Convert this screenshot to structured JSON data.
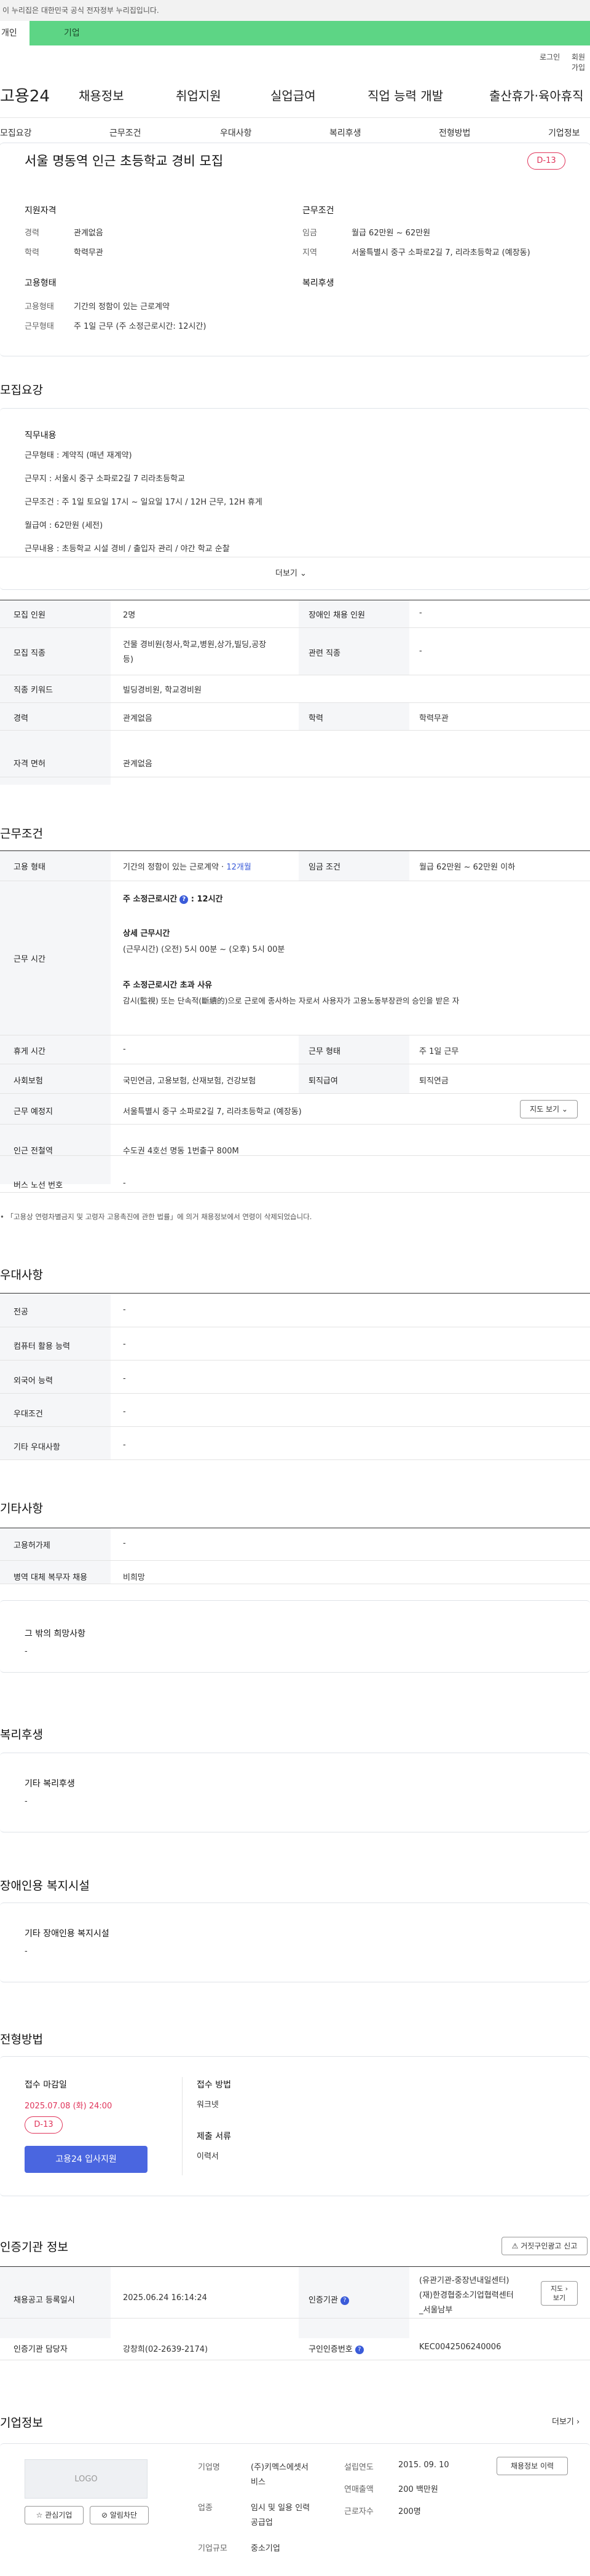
{
  "gov_bar": {
    "text": "이 누리집은 대한민국 공식 전자정부 누리집입니다."
  },
  "top_tabs": {
    "person": "개인",
    "company": "기업"
  },
  "util": {
    "login": "로그인",
    "signup": "회원가입"
  },
  "logo": "고용24",
  "gnb": [
    "채용정보",
    "취업지원",
    "실업급여",
    "직업 능력 개발",
    "출산휴가·육아휴직"
  ],
  "subnav": [
    "모집요강",
    "근무조건",
    "우대사항",
    "복리후생",
    "전형방법",
    "기업정보"
  ],
  "job": {
    "title": "서울 명동역 인근 초등학교 경비 모집",
    "dday": "D-13",
    "qual_heading": "지원자격",
    "career_label": "경력",
    "career_value": "관계없음",
    "edu_label": "학력",
    "edu_value": "학력무관",
    "cond_heading": "근무조건",
    "wage_label": "임금",
    "wage_value": "월급 62만원 ~ 62만원",
    "area_label": "지역",
    "area_value": "서울특별시 중구 소파로2길 7, 리라초등학교 (예장동)",
    "emp_heading": "고용형태",
    "emp_label": "고용형태",
    "emp_value": "기간의 정함이 있는 근로계약",
    "hours_label": "근무형태",
    "hours_value": "주 1일 근무 (주 소정근로시간: 12시간)",
    "welfare_heading": "복리후생"
  },
  "recruit": {
    "section_title": "모집요강",
    "detail_title": "직무내용",
    "lines": [
      "근무형태 : 계약직 (매년 재계약)",
      "근무지 : 서울시 중구 소파로2길 7 리라초등학교",
      "근무조건 : 주 1일 토요일  17시 ~ 일요일 17시 / 12H 근무, 12H 휴게",
      "월급여 : 62만원 (세전)",
      "근무내용 : 초등학교 시설 경비 / 출입자 관리 / 야간 학교 순찰"
    ],
    "more": "더보기",
    "table": [
      {
        "l1": "모집 인원",
        "v1": "2명",
        "l2": "장애인 채용 인원",
        "v2": "-"
      },
      {
        "l1": "모집 직종",
        "v1a": "건물 경비원(청사,학교,병원,상가,빌딩,공장",
        "v1b": "등)",
        "l2": "관련 직종",
        "v2": "-"
      },
      {
        "l1": "직종 키워드",
        "v1": "빌딩경비원, 학교경비원"
      },
      {
        "l1": "경력",
        "v1": "관계없음",
        "l2": "학력",
        "v2": "학력무관"
      },
      {
        "l1": "자격 면허",
        "v1": "관계없음"
      }
    ]
  },
  "work": {
    "section_title": "근무조건",
    "emp_label": "고용 형태",
    "emp_value": "기간의 정함이 있는 근로계약 · ",
    "emp_link": "12개월",
    "wage_label": "임금 조건",
    "wage_value": "월급 62만원 ~ 62만원 이하",
    "time_label": "근무 시간",
    "time_main": "주 소정근로시간",
    "time_main_value": ": 12시간",
    "time_detail_title": "상세 근무시간",
    "time_detail_value": "(근무시간) (오전) 5시 00분 ~ (오후) 5시 00분",
    "time_over_title": "주 소정근로시간 초과 사유",
    "time_over_value": "감시(監視) 또는 단속적(斷續的)으로 근로에 종사하는 자로서 사용자가 고용노동부장관의 승인을 받은 자",
    "rest_label": "휴게 시간",
    "rest_value": "-",
    "form_label": "근무 형태",
    "form_value": "주 1일 근무",
    "ins_label": "사회보험",
    "ins_value": "국민연금, 고용보험, 산재보험, 건강보험",
    "retire_label": "퇴직급여",
    "retire_value": "퇴직연금",
    "place_label": "근무 예정지",
    "place_value": "서울특별시 중구 소파로2길 7, 리라초등학교 (예장동)",
    "map_btn": "지도 보기",
    "subway_label": "인근 전철역",
    "subway_value": "수도권 4호선 명동 1번출구 800M",
    "bus_label": "버스 노선 번호",
    "bus_value": "-",
    "notice": "「고용상 연령차별금지 및 고령자 고용촉진에 관한 법률」에 의거 채용정보에서 연령이 삭제되었습니다."
  },
  "pref": {
    "section_title": "우대사항",
    "rows": [
      {
        "label": "전공",
        "value": "-"
      },
      {
        "label": "컴퓨터 활용 능력",
        "value": "-"
      },
      {
        "label": "외국어 능력",
        "value": "-"
      },
      {
        "label": "우대조건",
        "value": "-"
      },
      {
        "label": "기타 우대사항",
        "value": "-"
      }
    ]
  },
  "etc": {
    "section_title": "기타사항",
    "rows": [
      {
        "label": "고용허가제",
        "value": "-"
      },
      {
        "label": "병역 대체 복무자 채용",
        "value": "비희망"
      }
    ],
    "other_title": "그 밖의 희망사항",
    "other_value": "-"
  },
  "welfare": {
    "section_title": "복리후생",
    "box_title": "기타 복리후생",
    "box_value": "-"
  },
  "disability": {
    "section_title": "장애인용 복지시설",
    "box_title": "기타 장애인용 복지시설",
    "box_value": "-"
  },
  "process": {
    "section_title": "전형방법",
    "deadline_title": "접수 마감일",
    "deadline_value": "2025.07.08 (화) 24:00",
    "dday": "D-13",
    "apply_btn": "고용24 입사지원",
    "method_title": "접수 방법",
    "method_value": "워크넷",
    "docs_title": "제출 서류",
    "docs_value": "이력서"
  },
  "cert": {
    "section_title": "인증기관 정보",
    "report_btn": "거짓구인광고 신고",
    "reg_label": "채용공고 등록일시",
    "reg_value": "2025.06.24 16:14:24",
    "agency_label": "인증기관",
    "agency_value1": "(유관기관-중장년내일센터)",
    "agency_value2": "(재)한경협중소기업협력센터",
    "agency_value3": "_서울남부",
    "map_btn1": "지도",
    "map_btn2": "보기",
    "manager_label": "인증기관 담당자",
    "manager_value": "강창희(02-2639-2174)",
    "cert_no_label": "구인인증번호",
    "cert_no_value": "KEC0042506240006"
  },
  "company": {
    "section_title": "기업정보",
    "more": "더보기",
    "logo_text": "LOGO",
    "interest_btn": "관심기업",
    "alarm_btn": "알림차단",
    "name_label": "기업명",
    "name_value1": "(주)키멕스에셋서",
    "name_value2": "비스",
    "founded_label": "설립연도",
    "founded_value": "2015. 09. 10",
    "recruit_btn": "채용정보 이력",
    "industry_label": "업종",
    "industry_value1": "임시 및 일용 인력",
    "industry_value2": "공급업",
    "sales_label": "연매출액",
    "sales_value": "200 백만원",
    "emp_label": "근로자수",
    "emp_value": "200명",
    "size_label": "기업규모",
    "size_value": "중소기업"
  }
}
